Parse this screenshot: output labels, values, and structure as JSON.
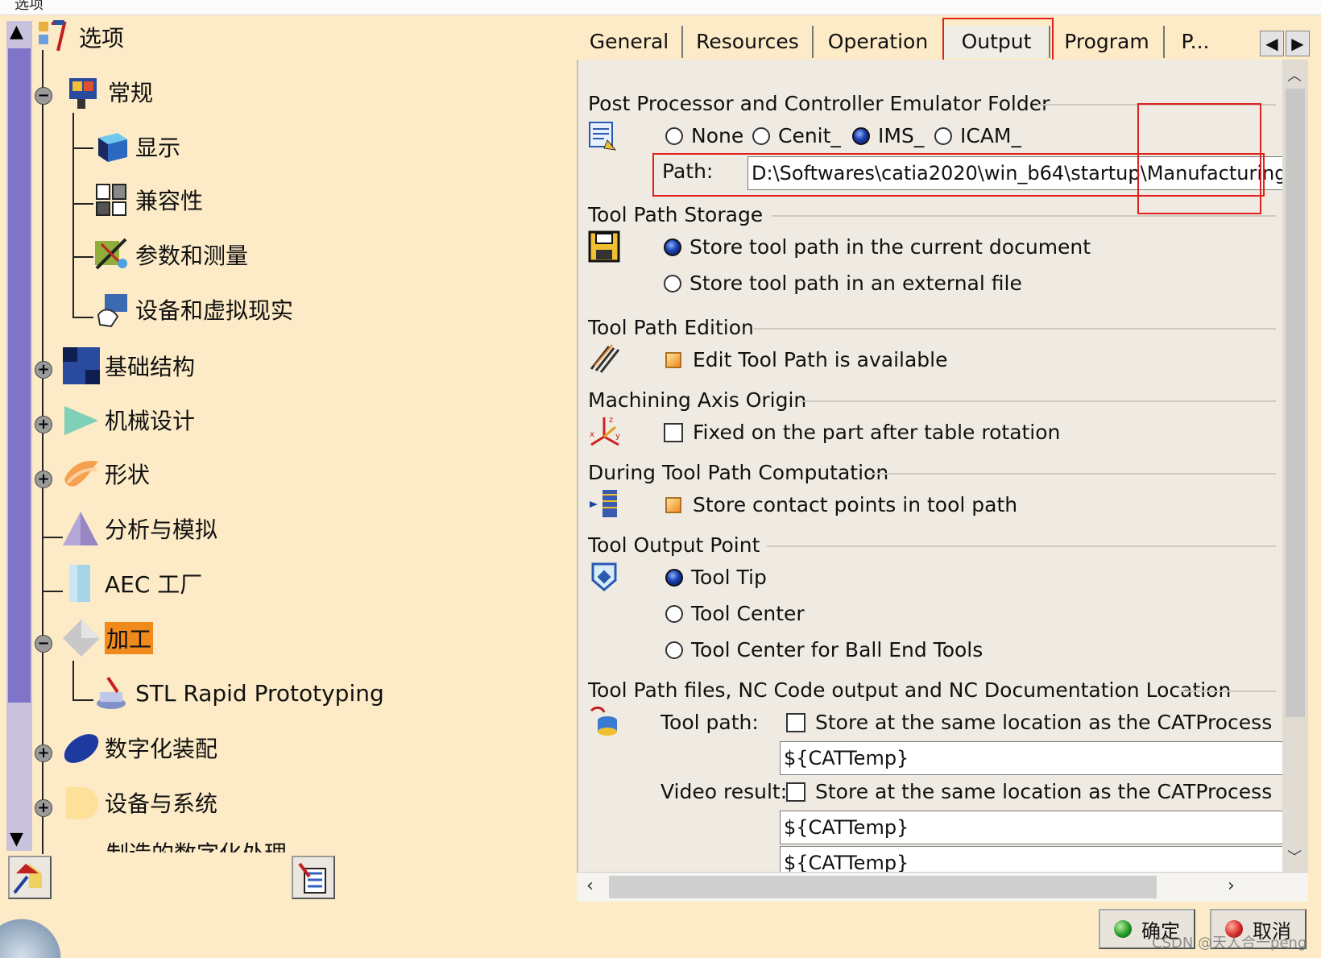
{
  "top_fragment": "选项",
  "tree": {
    "root": {
      "label": "选项",
      "icon": "options-tool-icon"
    },
    "items": [
      {
        "label": "常规",
        "icon": "general-monitor-icon"
      },
      {
        "label": "显示",
        "icon": "display-cube-icon"
      },
      {
        "label": "兼容性",
        "icon": "compatibility-icon"
      },
      {
        "label": "参数和测量",
        "icon": "parameters-measure-icon"
      },
      {
        "label": "设备和虚拟现实",
        "icon": "devices-vr-icon"
      },
      {
        "label": "基础结构",
        "icon": "infrastructure-icon"
      },
      {
        "label": "机械设计",
        "icon": "mechanical-design-icon"
      },
      {
        "label": "形状",
        "icon": "shape-icon"
      },
      {
        "label": "分析与模拟",
        "icon": "analysis-simulation-icon"
      },
      {
        "label": "AEC 工厂",
        "icon": "aec-plant-icon"
      },
      {
        "label": "加工",
        "icon": "machining-icon"
      },
      {
        "label": "STL Rapid Prototyping",
        "icon": "stl-prototyping-icon"
      },
      {
        "label": "数字化装配",
        "icon": "digital-assembly-icon"
      },
      {
        "label": "设备与系统",
        "icon": "equipment-systems-icon"
      },
      {
        "label": "制造的数字化处理",
        "icon": "digital-manufacturing-icon"
      }
    ],
    "selected": "加工"
  },
  "tabs": [
    {
      "label": "General"
    },
    {
      "label": "Resources"
    },
    {
      "label": "Operation"
    },
    {
      "label": "Output"
    },
    {
      "label": "Program"
    },
    {
      "label": "P..."
    }
  ],
  "active_tab": "Output",
  "sections": {
    "post_processor": {
      "title": "Post Processor and Controller Emulator Folder",
      "radios": [
        "None",
        "Cenit_",
        "IMS_",
        "ICAM_"
      ],
      "selected": "IMS_",
      "path_label": "Path:",
      "path_value": "D:\\Softwares\\catia2020\\win_b64\\startup\\Manufacturing"
    },
    "storage": {
      "title": "Tool Path Storage",
      "options": [
        "Store tool path in the current document",
        "Store tool path in an external file"
      ],
      "selected": "Store tool path in the current document"
    },
    "edition": {
      "title": "Tool Path Edition",
      "check": "Edit Tool Path is available",
      "checked": true
    },
    "axis": {
      "title": "Machining Axis Origin",
      "check": "Fixed on the part after table rotation",
      "checked": false
    },
    "computation": {
      "title": "During Tool Path Computation",
      "check": "Store contact points in tool path",
      "checked": true
    },
    "output_point": {
      "title": "Tool Output Point",
      "options": [
        "Tool Tip",
        "Tool Center",
        "Tool Center for Ball End Tools"
      ],
      "selected": "Tool Tip"
    },
    "files": {
      "title": "Tool Path files, NC Code output and NC Documentation Location",
      "toolpath_label": "Tool path:",
      "toolpath_check": "Store at the same location as the CATProcess",
      "toolpath_value": "${CATTemp}",
      "video_label": "Video result:",
      "video_check": "Store at the same location as the CATProcess",
      "video_value": "${CATTemp}",
      "third_value": "${CATTemp}"
    }
  },
  "buttons": {
    "ok": "确定",
    "cancel": "取消"
  },
  "watermark": "CSDN @天人合一peng",
  "colors": {
    "background": "#fcebc6",
    "selected": "#f08a1c",
    "highlight_box": "#e0201c"
  }
}
